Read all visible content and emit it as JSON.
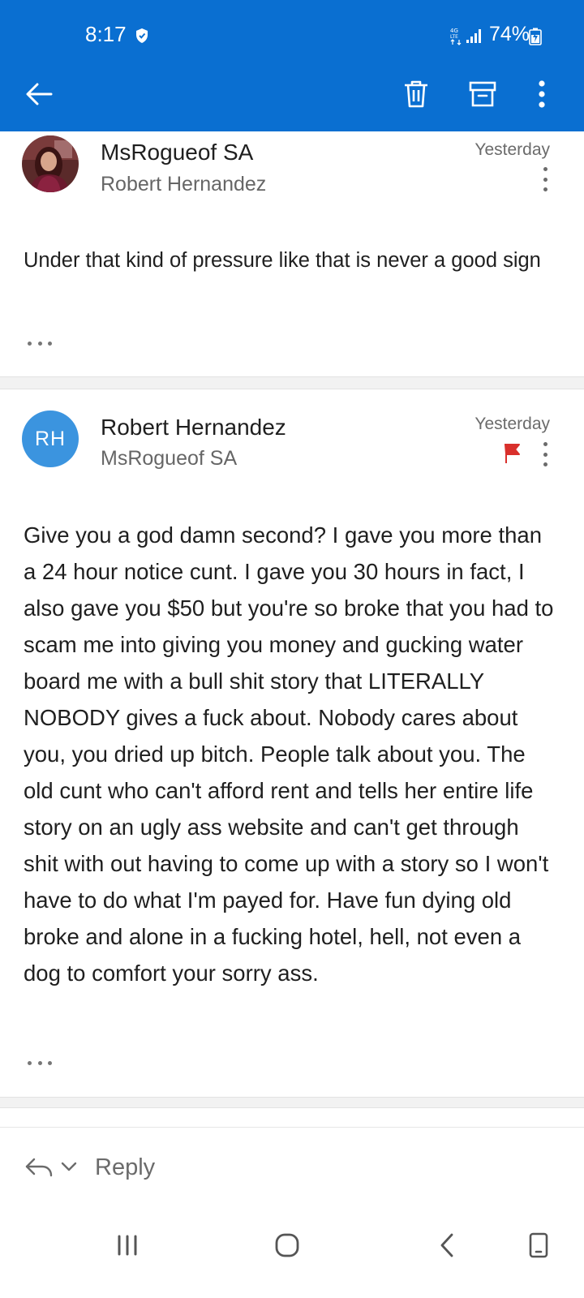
{
  "status_bar": {
    "time": "8:17",
    "network": "4G LTE",
    "battery": "74%"
  },
  "toolbar": {
    "back_icon": "arrow-left-icon",
    "delete_icon": "trash-icon",
    "archive_icon": "archive-icon",
    "more_icon": "more-vertical-icon",
    "color": "#0a6fd1"
  },
  "messages": [
    {
      "sender": "MsRogueof SA",
      "recipient": "Robert Hernandez",
      "date": "Yesterday",
      "body": "Under that kind of pressure like that is never a good sign",
      "avatar_type": "photo",
      "flagged": false
    },
    {
      "sender": "Robert Hernandez",
      "recipient": "MsRogueof SA",
      "date": "Yesterday",
      "avatar_initials": "RH",
      "avatar_color": "#3b94df",
      "flagged": true,
      "flag_color": "#d9302c",
      "body": "Give you a god damn second? I gave you more than a 24 hour notice cunt. I gave you 30 hours in fact, I also gave you $50 but you're so broke that you had to scam me into giving you money and gucking water board me with a bull shit story that LITERALLY NOBODY gives a fuck about. Nobody cares about you, you dried up bitch. People talk about you. The old cunt who can't afford rent and tells her entire life story on an ugly ass website and can't get through shit with out having to come up with a story so I won't have to do what I'm payed for. Have fun dying old broke and alone in a fucking hotel, hell, not even a dog to comfort your sorry ass."
    }
  ],
  "reply_bar": {
    "label": "Reply"
  },
  "nav_bar": {
    "recents_icon": "recents-icon",
    "home_icon": "home-icon",
    "back_icon": "nav-back-icon",
    "rotate_icon": "rotate-icon"
  }
}
